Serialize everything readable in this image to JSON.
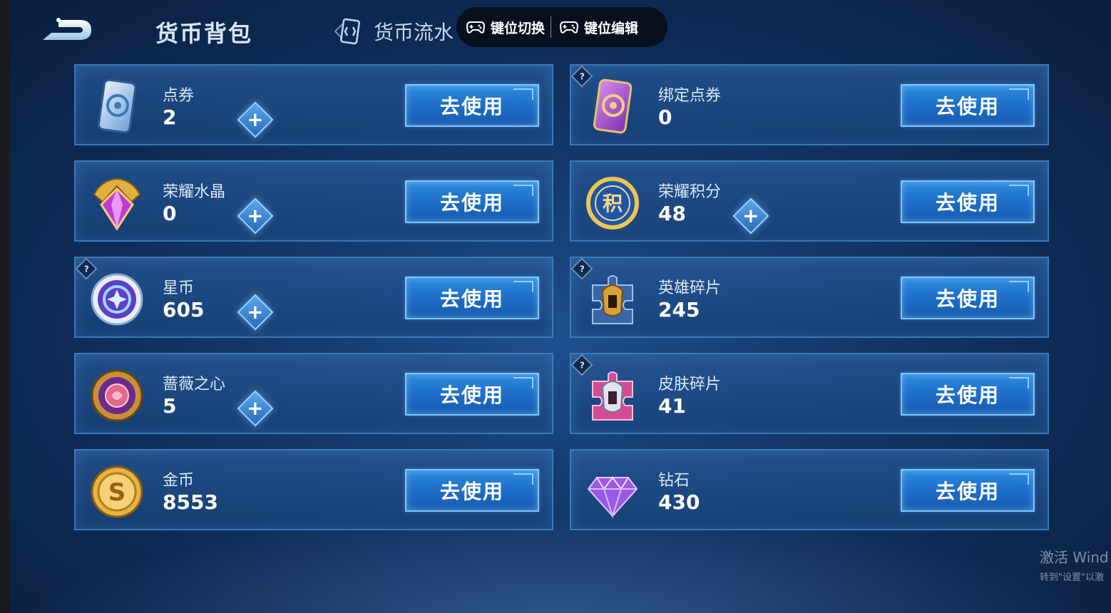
{
  "header": {
    "title": "货币背包",
    "tab_flow": "货币流水"
  },
  "keymap_bar": {
    "switch_label": "键位切换",
    "edit_label": "键位编辑"
  },
  "cards": [
    {
      "name": "点券",
      "value": "2",
      "has_plus": true,
      "has_help": false,
      "button": "去使用",
      "icon": "coupon-card-icon"
    },
    {
      "name": "绑定点券",
      "value": "0",
      "has_plus": false,
      "has_help": true,
      "button": "去使用",
      "icon": "bound-coupon-card-icon"
    },
    {
      "name": "荣耀水晶",
      "value": "0",
      "has_plus": true,
      "has_help": false,
      "button": "去使用",
      "icon": "glory-crystal-icon"
    },
    {
      "name": "荣耀积分",
      "value": "48",
      "has_plus": true,
      "has_help": false,
      "button": "去使用",
      "icon": "glory-points-icon"
    },
    {
      "name": "星币",
      "value": "605",
      "has_plus": true,
      "has_help": true,
      "button": "去使用",
      "icon": "star-coin-icon"
    },
    {
      "name": "英雄碎片",
      "value": "245",
      "has_plus": false,
      "has_help": true,
      "button": "去使用",
      "icon": "hero-fragment-icon"
    },
    {
      "name": "蔷薇之心",
      "value": "5",
      "has_plus": true,
      "has_help": false,
      "button": "去使用",
      "icon": "rose-heart-icon"
    },
    {
      "name": "皮肤碎片",
      "value": "41",
      "has_plus": false,
      "has_help": true,
      "button": "去使用",
      "icon": "skin-fragment-icon"
    },
    {
      "name": "金币",
      "value": "8553",
      "has_plus": false,
      "has_help": false,
      "button": "去使用",
      "icon": "gold-coin-icon"
    },
    {
      "name": "钻石",
      "value": "430",
      "has_plus": false,
      "has_help": false,
      "button": "去使用",
      "icon": "diamond-icon"
    }
  ],
  "watermark": {
    "title": "激活 Wind",
    "subtitle": "转到\"设置\"以激"
  },
  "colors": {
    "accent": "#2d8be0",
    "card_border": "#3a79b8",
    "background": "#15396d"
  }
}
